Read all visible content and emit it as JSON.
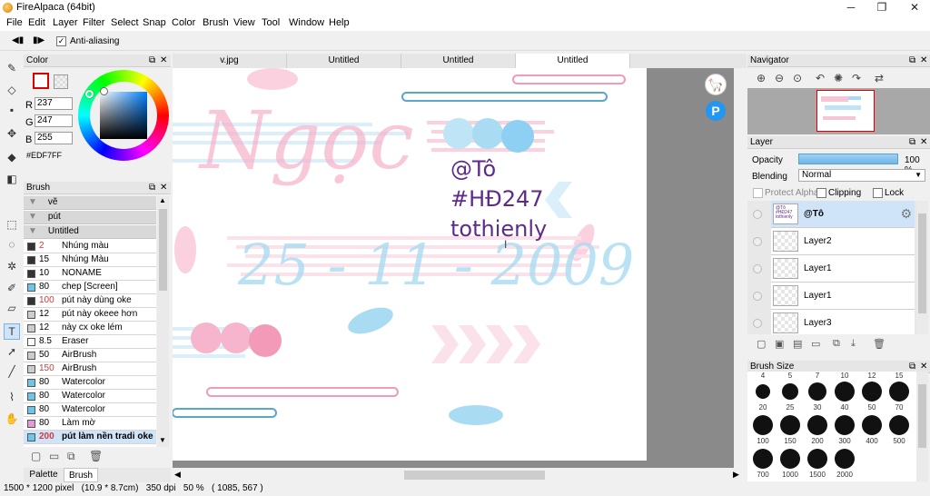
{
  "window": {
    "title": "FireAlpaca (64bit)",
    "minimize": "─",
    "maximize": "❐",
    "close": "✕"
  },
  "menu": [
    "File",
    "Edit",
    "Layer",
    "Filter",
    "Select",
    "Snap",
    "Color",
    "Brush",
    "View",
    "Tool",
    "Window",
    "Help"
  ],
  "toolbar": {
    "anti_aliasing": "Anti-aliasing"
  },
  "color_panel": {
    "title": "Color",
    "r_label": "R",
    "r": "237",
    "g_label": "G",
    "g": "247",
    "b_label": "B",
    "b": "255",
    "hex": "#EDF7FF"
  },
  "brush_panel": {
    "title": "Brush",
    "groups": [
      "vẽ",
      "pút",
      "Untitled"
    ],
    "items": [
      {
        "size": "2",
        "name": "Nhúng màu",
        "color": "#333333",
        "red": true
      },
      {
        "size": "15",
        "name": "Nhúng Màu",
        "color": "#333333",
        "red": false
      },
      {
        "size": "10",
        "name": "NONAME",
        "color": "#333333",
        "red": false
      },
      {
        "size": "80",
        "name": "chep [Screen]",
        "color": "#6cc6e6",
        "red": false
      },
      {
        "size": "100",
        "name": "pút này dùng oke",
        "color": "#333333",
        "red": true
      },
      {
        "size": "12",
        "name": "pút này okeee hơn",
        "color": "#cccccc",
        "red": false
      },
      {
        "size": "12",
        "name": "này cx oke lém",
        "color": "#cccccc",
        "red": false
      },
      {
        "size": "8.5",
        "name": "Eraser",
        "color": "#ffffff",
        "red": false
      },
      {
        "size": "50",
        "name": "AirBrush",
        "color": "#cccccc",
        "red": false
      },
      {
        "size": "150",
        "name": "AirBrush",
        "color": "#cccccc",
        "red": true
      },
      {
        "size": "80",
        "name": "Watercolor",
        "color": "#6cc6e6",
        "red": false
      },
      {
        "size": "80",
        "name": "Watercolor",
        "color": "#6cc6e6",
        "red": false
      },
      {
        "size": "80",
        "name": "Watercolor",
        "color": "#6cc6e6",
        "red": false
      },
      {
        "size": "80",
        "name": "Làm mờ",
        "color": "#e59ad8",
        "red": false
      },
      {
        "size": "200",
        "name": "pút làm nền tradi oke",
        "color": "#6cc6e6",
        "red": true
      }
    ]
  },
  "bottom_tabs": {
    "palette": "Palette",
    "brush": "Brush"
  },
  "doc_tabs": [
    "v.jpg",
    "Untitled",
    "Untitled",
    "Untitled"
  ],
  "canvas_art": {
    "script_text": "Ngọc",
    "date_text": "25 - 11 - 2009",
    "lines": [
      "@Tô",
      "#HĐ247",
      "tothienly"
    ]
  },
  "navigator": {
    "title": "Navigator"
  },
  "layer_panel": {
    "title": "Layer",
    "opacity_label": "Opacity",
    "opacity_value": "100 %",
    "blending_label": "Blending",
    "blending_value": "Normal",
    "protect_alpha": "Protect Alpha",
    "clipping": "Clipping",
    "lock": "Lock",
    "layers": [
      {
        "name": "@Tô",
        "selected": true,
        "thumb_text": "@Tô\n#HĐ247\ntothienly"
      },
      {
        "name": "Layer2",
        "selected": false
      },
      {
        "name": "Layer1",
        "selected": false
      },
      {
        "name": "Layer1",
        "selected": false
      },
      {
        "name": "Layer3",
        "selected": false
      }
    ]
  },
  "brush_size": {
    "title": "Brush Size",
    "top_labels": [
      "4",
      "5",
      "7",
      "10",
      "12",
      "15"
    ],
    "rows": [
      [
        "20",
        "25",
        "30",
        "40",
        "50",
        "70"
      ],
      [
        "100",
        "150",
        "200",
        "300",
        "400",
        "500"
      ],
      [
        "700",
        "1000",
        "1500",
        "2000"
      ]
    ]
  },
  "status": {
    "text": "1500 * 1200 pixel   (10.9 * 8.7cm)   350 dpi   50 %   ( 1085, 567 )"
  },
  "colors": {
    "accent": "#7fb1e0",
    "pink": "#f6b5cc",
    "blue": "#a9dbf3",
    "purple": "#5e2b8c"
  }
}
